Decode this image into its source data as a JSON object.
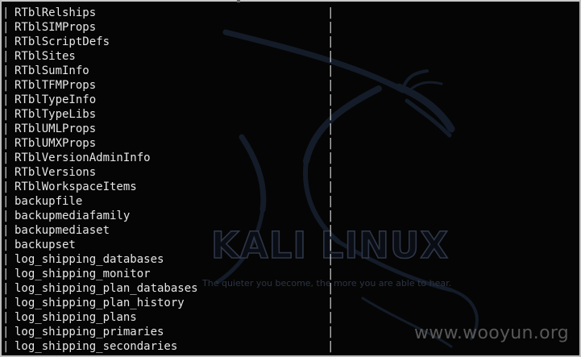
{
  "terminal": {
    "separator": "|",
    "rows": [
      "RTblRelships",
      "RTblSIMProps",
      "RTblScriptDefs",
      "RTblSites",
      "RTblSumInfo",
      "RTblTFMProps",
      "RTblTypeInfo",
      "RTblTypeLibs",
      "RTblUMLProps",
      "RTblUMXProps",
      "RTblVersionAdminInfo",
      "RTblVersions",
      "RTblWorkspaceItems",
      "backupfile",
      "backupmediafamily",
      "backupmediaset",
      "backupset",
      "log_shipping_databases",
      "log_shipping_monitor",
      "log_shipping_plan_databases",
      "log_shipping_plan_history",
      "log_shipping_plans",
      "log_shipping_primaries",
      "log_shipping_secondaries"
    ]
  },
  "wallpaper": {
    "logo_text": "KALI LINUX",
    "tagline": "The quieter you become, the more you are able to hear.",
    "dragon_icon": "kali-dragon-icon"
  },
  "watermark": {
    "text": "www.wooyun.org"
  },
  "colors": {
    "background": "#050505",
    "text": "#e6e6e6",
    "logo_outline": "#2e3748",
    "watermark": "#585858"
  }
}
